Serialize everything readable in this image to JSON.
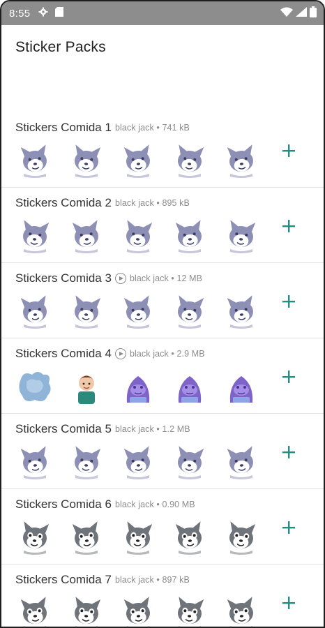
{
  "status_bar": {
    "time": "8:55",
    "icons": [
      "gear-icon",
      "sd-card-icon",
      "wifi-icon",
      "signal-icon",
      "battery-icon"
    ]
  },
  "header": {
    "title": "Sticker Packs"
  },
  "colors": {
    "accent": "#1f8f84",
    "status_bar": "#8d8d8d"
  },
  "packs": [
    {
      "name": "Stickers Comida 1",
      "animated": false,
      "meta": "black jack • 741 kB",
      "stickers": [
        "wolf-sticker-icon",
        "wolf-sticker-icon",
        "wolf-sticker-icon",
        "wolf-sticker-icon",
        "wolf-sticker-icon"
      ]
    },
    {
      "name": "Stickers Comida 2",
      "animated": false,
      "meta": "black jack • 895 kB",
      "stickers": [
        "wolf-sticker-icon",
        "wolf-sticker-icon",
        "wolf-sticker-icon",
        "wolf-sticker-icon",
        "wolf-sticker-icon"
      ]
    },
    {
      "name": "Stickers Comida 3",
      "animated": true,
      "meta": "black jack • 12 MB",
      "stickers": [
        "wolf-sticker-icon",
        "wolf-sticker-icon",
        "wolf-sticker-icon",
        "wolf-sticker-icon",
        "wolf-sticker-icon"
      ]
    },
    {
      "name": "Stickers Comida 4",
      "animated": true,
      "meta": "black jack • 2.9 MB",
      "stickers": [
        "splash-sticker-icon",
        "person-sticker-icon",
        "purple-character-sticker-icon",
        "purple-character-sticker-icon",
        "purple-character-sticker-icon"
      ]
    },
    {
      "name": "Stickers Comida 5",
      "animated": false,
      "meta": "black jack • 1.2 MB",
      "stickers": [
        "wolf-sticker-icon",
        "wolf-sticker-icon",
        "wolf-sticker-icon",
        "wolf-sticker-icon",
        "wolf-sticker-icon"
      ]
    },
    {
      "name": "Stickers Comida 6",
      "animated": false,
      "meta": "black jack • 0.90 MB",
      "stickers": [
        "husky-sticker-icon",
        "husky-sticker-icon",
        "husky-sticker-icon",
        "husky-sticker-icon",
        "husky-sticker-icon"
      ]
    },
    {
      "name": "Stickers Comida 7",
      "animated": false,
      "meta": "black jack • 897 kB",
      "stickers": [
        "husky-sticker-icon",
        "husky-sticker-icon",
        "husky-sticker-icon",
        "husky-sticker-icon",
        "husky-sticker-icon"
      ]
    }
  ]
}
